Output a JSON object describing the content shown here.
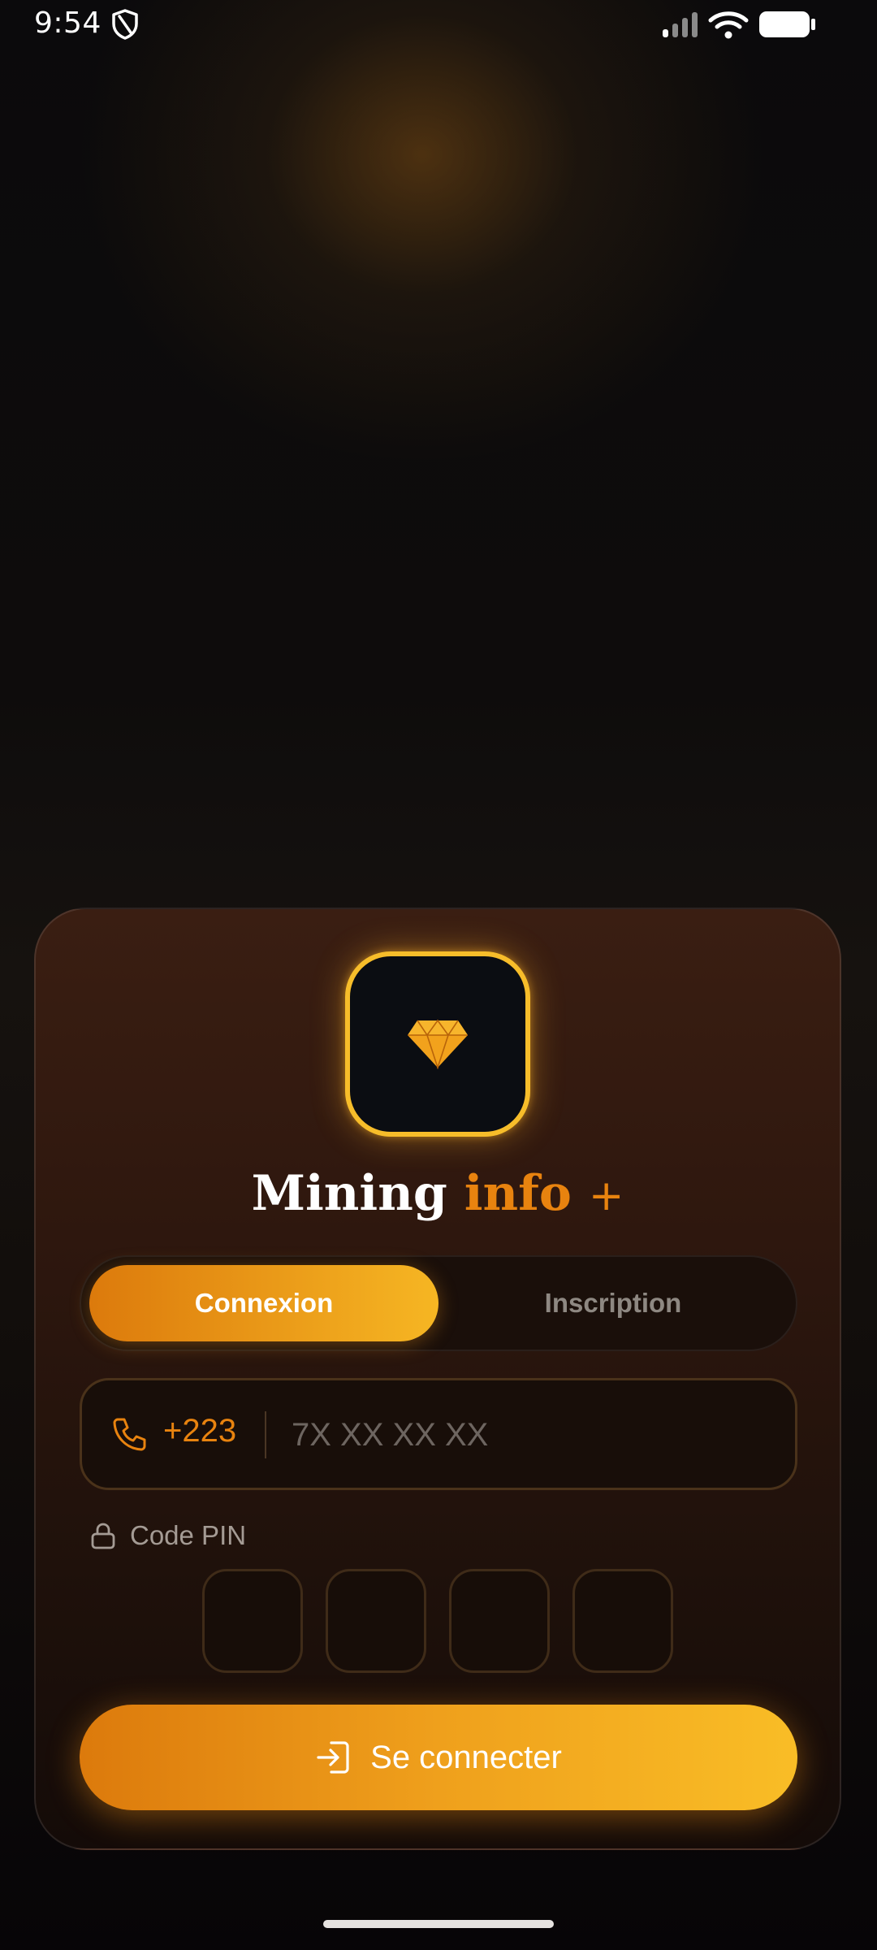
{
  "status_bar": {
    "time": "9:54",
    "icons": [
      "shield-icon",
      "signal-icon",
      "wifi-icon",
      "battery-icon"
    ]
  },
  "app": {
    "logo_icon": "diamond-icon",
    "title_part1": "Mining",
    "title_part2": "info",
    "title_part3": "+"
  },
  "tabs": {
    "login": "Connexion",
    "signup": "Inscription",
    "active": "login"
  },
  "phone": {
    "icon": "phone-icon",
    "prefix": "+223",
    "placeholder": "7X XX XX XX",
    "value": ""
  },
  "pin": {
    "icon": "lock-icon",
    "label": "Code PIN",
    "digits": [
      "",
      "",
      "",
      ""
    ]
  },
  "submit": {
    "icon": "login-icon",
    "label": "Se connecter"
  },
  "colors": {
    "accent": "#e8830f",
    "accent_light": "#f9bd26",
    "card_bg": "#2e170e",
    "background": "#0b0a0c"
  }
}
